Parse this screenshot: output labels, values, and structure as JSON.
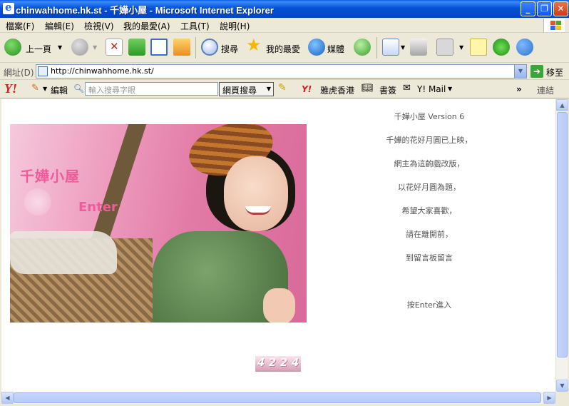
{
  "window": {
    "title": "chinwahhome.hk.st - 千嬅小屋 - Microsoft Internet Explorer",
    "minimize": "_",
    "restore": "❐",
    "close": "✕"
  },
  "menu": [
    "檔案(F)",
    "編輯(E)",
    "檢視(V)",
    "我的最愛(A)",
    "工具(T)",
    "說明(H)"
  ],
  "toolbar": {
    "back": "上一頁",
    "search": "搜尋",
    "favorites": "我的最愛",
    "media": "媒體"
  },
  "address": {
    "label": "網址(D)",
    "url": "http://chinwahhome.hk.st/",
    "go": "移至"
  },
  "yahoo": {
    "logo": "Y!",
    "edit": "編輯",
    "search_placeholder": "輸入搜尋字眼",
    "search_button": "網頁搜尋",
    "hk": "雅虎香港",
    "bookmarks": "書簽",
    "mail": "Y! Mail",
    "links": "連結",
    "more": "»"
  },
  "page": {
    "image_title": "千嬅小屋",
    "image_enter": "Enter",
    "lines": [
      "千嬅小屋 Version 6",
      "千嬅的花好月圓已上映，",
      "網主為這齣戲改版，",
      "以花好月圓為題，",
      "希望大家喜歡，",
      "請在離開前，",
      "到留言板留言",
      "按Enter進入"
    ],
    "counter": [
      "4",
      "2",
      "2",
      "4"
    ]
  },
  "colors": {
    "titlebar": "#0551d6",
    "accent_pink": "#f05b9c"
  }
}
